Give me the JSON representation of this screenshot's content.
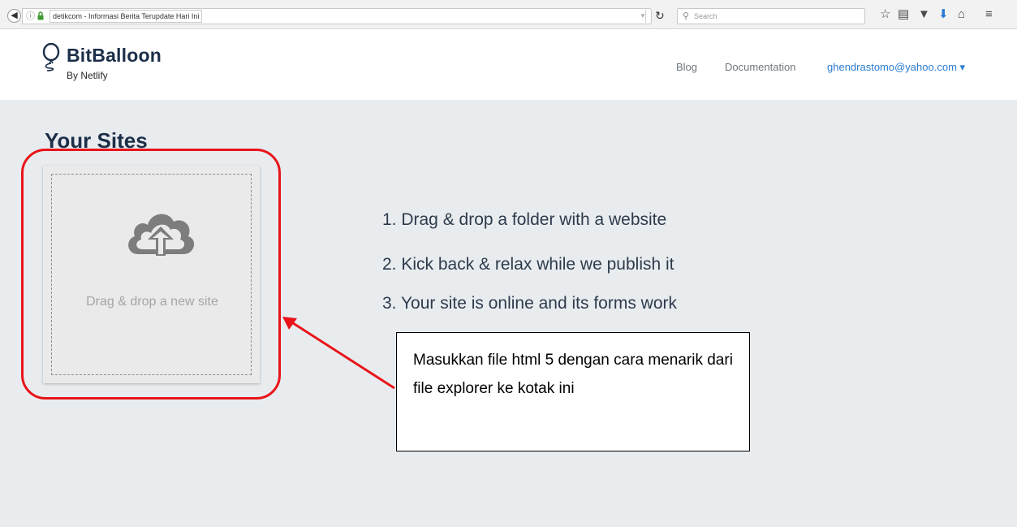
{
  "browser": {
    "tab_title": "detikcom - Informasi Berita Terupdate Hari Ini",
    "search_placeholder": "Search",
    "icons": [
      "back-icon",
      "info-icon",
      "lock-icon",
      "reload-icon",
      "search-icon",
      "bookmark-star-icon",
      "clipboard-icon",
      "pocket-icon",
      "download-icon",
      "home-icon",
      "menu-icon"
    ]
  },
  "header": {
    "brand_name": "BitBalloon",
    "brand_sub": "By Netlify",
    "nav": {
      "blog": "Blog",
      "documentation": "Documentation",
      "user": "ghendrastomo@yahoo.com ▾"
    }
  },
  "main": {
    "title": "Your Sites",
    "dropzone_text": "Drag & drop a new site",
    "steps": [
      "1. Drag & drop a folder with a website",
      "2. Kick back & relax while we publish it",
      "3. Your site is online and its forms work"
    ]
  },
  "annotation": {
    "callout_text": "Masukkan file html 5 dengan cara menarik dari file explorer ke kotak ini",
    "accent_color": "#e8141a"
  }
}
